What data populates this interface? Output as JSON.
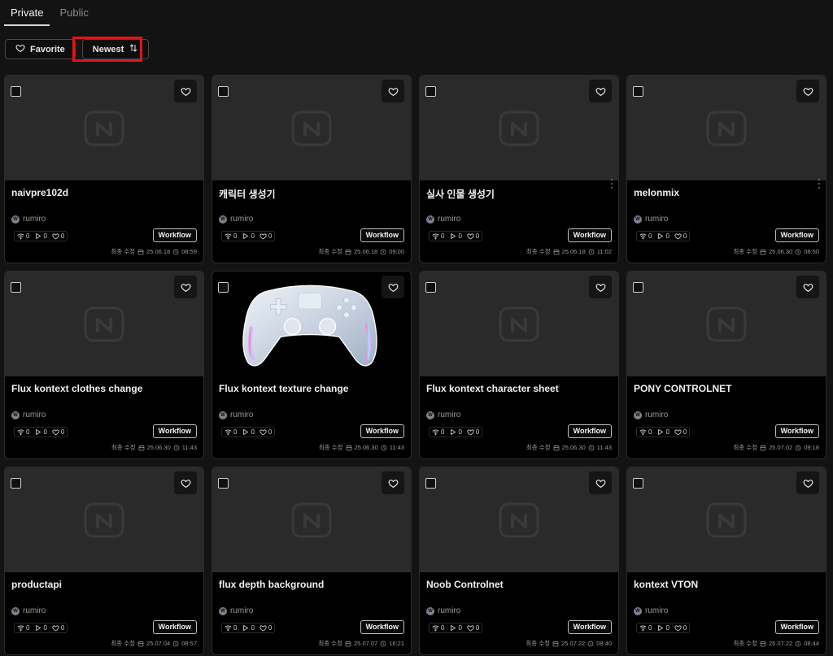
{
  "tabs": [
    {
      "label": "Private",
      "active": true
    },
    {
      "label": "Public",
      "active": false
    }
  ],
  "toolbar": {
    "favorite_label": "Favorite",
    "sort_label": "Newest"
  },
  "colors": {
    "highlight": "#e01414",
    "background": "#131313",
    "card_thumb": "#2a2a2a"
  },
  "cards": [
    {
      "title": "naivpre102d",
      "author": "rumiro",
      "avatar_letter": "W",
      "views": "0",
      "runs": "0",
      "likes": "0",
      "type": "Workflow",
      "modified_label": "최종 수정",
      "date": "25.06.18",
      "time": "08:59",
      "menu": false,
      "image": false
    },
    {
      "title": "캐릭터 생성기",
      "author": "rumiro",
      "avatar_letter": "W",
      "views": "0",
      "runs": "0",
      "likes": "0",
      "type": "Workflow",
      "modified_label": "최종 수정",
      "date": "25.06.18",
      "time": "09:00",
      "menu": false,
      "image": false
    },
    {
      "title": "실사 인물 생성기",
      "author": "rumiro",
      "avatar_letter": "W",
      "views": "0",
      "runs": "0",
      "likes": "0",
      "type": "Workflow",
      "modified_label": "최종 수정",
      "date": "25.06.18",
      "time": "11:02",
      "menu": true,
      "image": false
    },
    {
      "title": "melonmix",
      "author": "rumiro",
      "avatar_letter": "W",
      "views": "0",
      "runs": "0",
      "likes": "0",
      "type": "Workflow",
      "modified_label": "최종 수정",
      "date": "25.06.30",
      "time": "08:50",
      "menu": true,
      "image": false
    },
    {
      "title": "Flux kontext clothes change",
      "author": "rumiro",
      "avatar_letter": "W",
      "views": "0",
      "runs": "0",
      "likes": "0",
      "type": "Workflow",
      "modified_label": "최종 수정",
      "date": "25.06.30",
      "time": "11:43",
      "menu": false,
      "image": false
    },
    {
      "title": "Flux kontext texture change",
      "author": "rumiro",
      "avatar_letter": "W",
      "views": "0",
      "runs": "0",
      "likes": "0",
      "type": "Workflow",
      "modified_label": "최종 수정",
      "date": "25.06.30",
      "time": "11:43",
      "menu": false,
      "image": true
    },
    {
      "title": "Flux kontext character sheet",
      "author": "rumiro",
      "avatar_letter": "W",
      "views": "0",
      "runs": "0",
      "likes": "0",
      "type": "Workflow",
      "modified_label": "최종 수정",
      "date": "25.06.30",
      "time": "11:43",
      "menu": false,
      "image": false
    },
    {
      "title": "PONY CONTROLNET",
      "author": "rumiro",
      "avatar_letter": "W",
      "views": "0",
      "runs": "0",
      "likes": "0",
      "type": "Workflow",
      "modified_label": "최종 수정",
      "date": "25.07.02",
      "time": "09:18",
      "menu": false,
      "image": false
    },
    {
      "title": "productapi",
      "author": "rumiro",
      "avatar_letter": "W",
      "views": "0",
      "runs": "0",
      "likes": "0",
      "type": "Workflow",
      "modified_label": "최종 수정",
      "date": "25.07.04",
      "time": "08:57",
      "menu": false,
      "image": false
    },
    {
      "title": "flux depth background",
      "author": "rumiro",
      "avatar_letter": "W",
      "views": "0",
      "runs": "0",
      "likes": "0",
      "type": "Workflow",
      "modified_label": "최종 수정",
      "date": "25.07.07",
      "time": "16:21",
      "menu": false,
      "image": false
    },
    {
      "title": "Noob Controlnet",
      "author": "rumiro",
      "avatar_letter": "W",
      "views": "0",
      "runs": "0",
      "likes": "0",
      "type": "Workflow",
      "modified_label": "최종 수정",
      "date": "25.07.22",
      "time": "08:40",
      "menu": false,
      "image": false
    },
    {
      "title": "kontext VTON",
      "author": "rumiro",
      "avatar_letter": "W",
      "views": "0",
      "runs": "0",
      "likes": "0",
      "type": "Workflow",
      "modified_label": "최종 수정",
      "date": "25.07.22",
      "time": "08:44",
      "menu": false,
      "image": false
    }
  ]
}
